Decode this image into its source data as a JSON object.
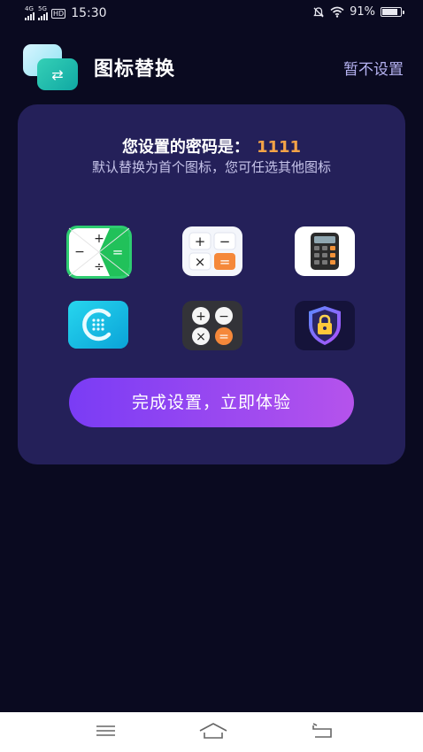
{
  "status_bar": {
    "network_1": "4G",
    "network_2": "5G",
    "hd_label": "HD",
    "time": "15:30",
    "battery": "91%",
    "battery_level": 0.91,
    "icons": [
      "signal-4g-icon",
      "signal-5g-icon",
      "hd-icon",
      "mute-icon",
      "wifi-icon",
      "battery-icon"
    ]
  },
  "header": {
    "title": "图标替换",
    "skip_label": "暂不设置",
    "logo_icon": "swap-icon"
  },
  "card": {
    "password_label": "您设置的密码是：",
    "password_value": "1111",
    "hint": "默认替换为首个图标，您可任选其他图标",
    "icons": [
      {
        "name": "calculator-green-icon",
        "glyphs": [
          "+",
          "−",
          "÷",
          "="
        ]
      },
      {
        "name": "calculator-white-icon",
        "glyphs": [
          "+",
          "−",
          "×",
          "="
        ]
      },
      {
        "name": "calculator-black-icon"
      },
      {
        "name": "cyan-calculator-icon"
      },
      {
        "name": "calculator-dark-icon",
        "glyphs": [
          "+",
          "−",
          "×",
          "="
        ]
      },
      {
        "name": "shield-lock-icon"
      }
    ],
    "cta_label": "完成设置，立即体验"
  },
  "colors": {
    "background": "#0a0a20",
    "card": "#242059",
    "accent_password": "#f4a347",
    "skip_link": "#b6b3f2",
    "cta_start": "#7a3cf5",
    "cta_end": "#b553ec"
  },
  "nav_bar": {
    "icons": [
      "menu-icon",
      "home-icon",
      "back-icon"
    ]
  }
}
